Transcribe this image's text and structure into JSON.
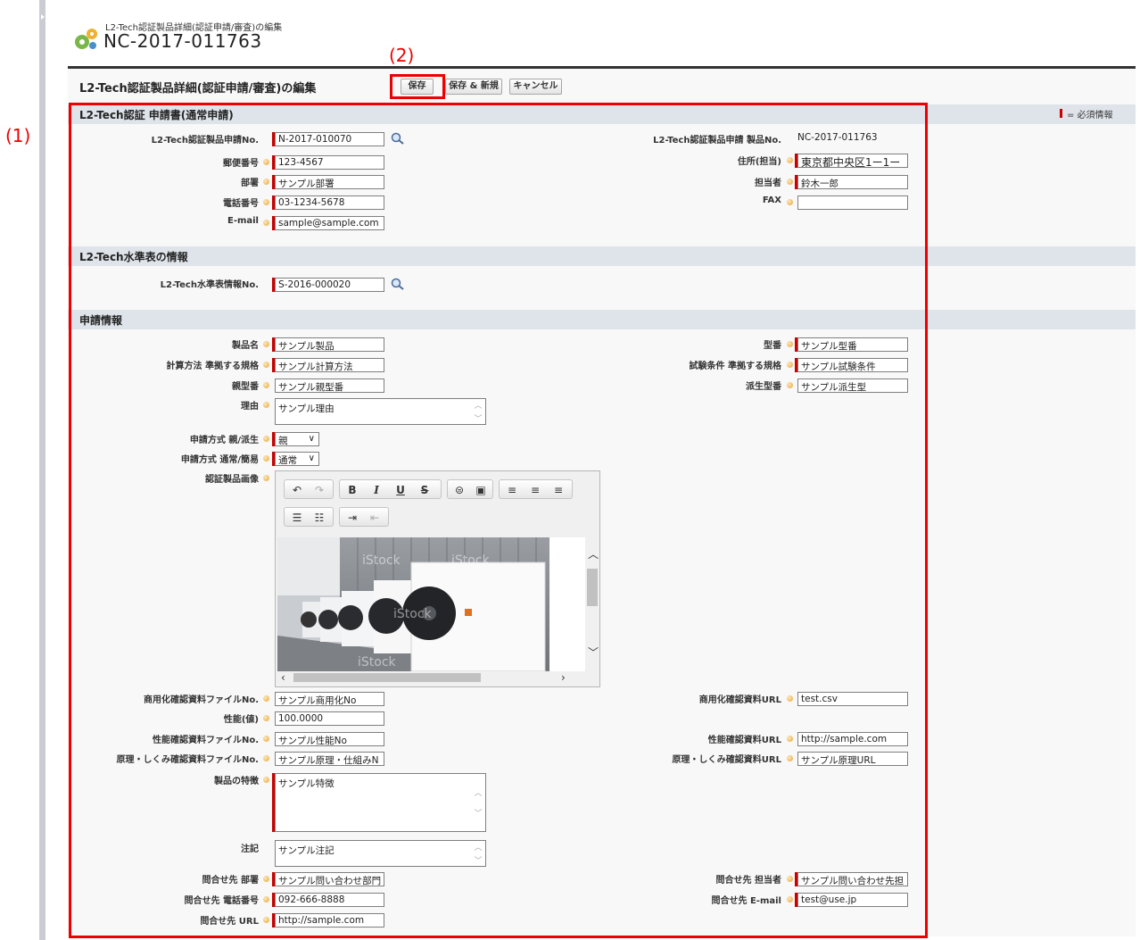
{
  "header": {
    "subtitle": "L2-Tech認証製品詳細(認証申請/審査)の編集",
    "title": "NC-2017-011763"
  },
  "edit": {
    "title": "L2-Tech認証製品詳細(認証申請/審査)の編集",
    "save_label": "保存",
    "save_new_label": "保存 & 新規",
    "cancel_label": "キャンセル",
    "required_legend": "= 必須情報"
  },
  "annotations": {
    "box1": "(1)",
    "box2": "(2)"
  },
  "sections": {
    "s1": "L2-Tech認証 申請書(通常申請)",
    "s2": "L2-Tech水準表の情報",
    "s3": "申請情報"
  },
  "fields": {
    "app_no": {
      "label": "L2-Tech認証製品申請No.",
      "value": "N-2017-010070"
    },
    "prod_no": {
      "label": "L2-Tech認証製品申請 製品No.",
      "value": "NC-2017-011763"
    },
    "postal": {
      "label": "郵便番号",
      "value": "123-4567"
    },
    "address": {
      "label": "住所(担当)",
      "value": "東京都中央区1ー1ー"
    },
    "dept": {
      "label": "部署",
      "value": "サンプル部署"
    },
    "person": {
      "label": "担当者",
      "value": "鈴木一郎"
    },
    "phone": {
      "label": "電話番号",
      "value": "03-1234-5678"
    },
    "fax": {
      "label": "FAX",
      "value": ""
    },
    "email": {
      "label": "E-mail",
      "value": "sample@sample.com"
    },
    "level_no": {
      "label": "L2-Tech水準表情報No.",
      "value": "S-2016-000020"
    },
    "product_name": {
      "label": "製品名",
      "value": "サンプル製品"
    },
    "model": {
      "label": "型番",
      "value": "サンプル型番"
    },
    "calc_method": {
      "label": "計算方法 準拠する規格",
      "value": "サンプル計算方法"
    },
    "test_cond": {
      "label": "試験条件 準拠する規格",
      "value": "サンプル試験条件"
    },
    "parent_model": {
      "label": "親型番",
      "value": "サンプル親型番"
    },
    "derived_model": {
      "label": "派生型番",
      "value": "サンプル派生型"
    },
    "reason": {
      "label": "理由",
      "value": "サンプル理由"
    },
    "method_parent": {
      "label": "申請方式 親/派生",
      "value": "親"
    },
    "method_normal": {
      "label": "申請方式 通常/簡易",
      "value": "通常"
    },
    "image": {
      "label": "認証製品画像"
    },
    "comm_file": {
      "label": "商用化確認資料ファイルNo.",
      "value": "サンプル商用化No"
    },
    "comm_url": {
      "label": "商用化確認資料URL",
      "value": "test.csv"
    },
    "perf_value": {
      "label": "性能(値)",
      "value": "100.0000"
    },
    "perf_file": {
      "label": "性能確認資料ファイルNo.",
      "value": "サンプル性能No"
    },
    "perf_url": {
      "label": "性能確認資料URL",
      "value": "http://sample.com"
    },
    "principle_file": {
      "label": "原理・しくみ確認資料ファイルNo.",
      "value": "サンプル原理・仕組みN"
    },
    "principle_url": {
      "label": "原理・しくみ確認資料URL",
      "value": "サンプル原理URL"
    },
    "features": {
      "label": "製品の特徴",
      "value": "サンプル特徴"
    },
    "notes": {
      "label": "注記",
      "value": "サンプル注記"
    },
    "contact_dept": {
      "label": "問合せ先 部署",
      "value": "サンプル問い合わせ部門"
    },
    "contact_person": {
      "label": "問合せ先 担当者",
      "value": "サンプル問い合わせ先担"
    },
    "contact_phone": {
      "label": "問合せ先 電話番号",
      "value": "092-666-8888"
    },
    "contact_email": {
      "label": "問合せ先 E-mail",
      "value": "test@use.jp"
    },
    "contact_url": {
      "label": "問合せ先 URL",
      "value": "http://sample.com"
    }
  },
  "image_watermark": "iStock",
  "colors": {
    "required": "#cc0000",
    "annotation": "#ee0000",
    "section_bg": "#dfe4ea"
  }
}
